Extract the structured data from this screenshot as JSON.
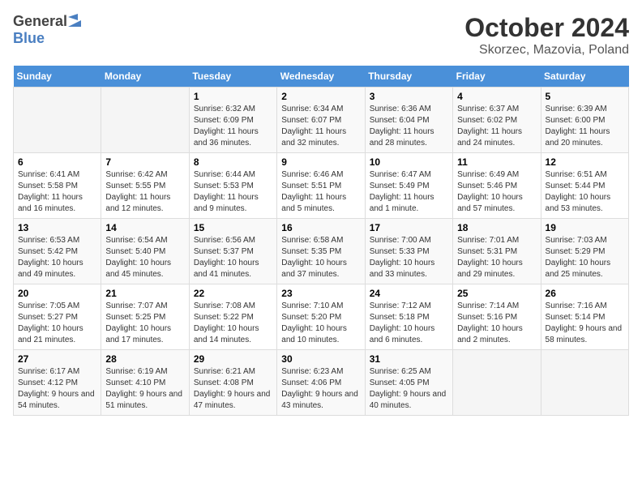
{
  "header": {
    "logo_general": "General",
    "logo_blue": "Blue",
    "month": "October 2024",
    "location": "Skorzec, Mazovia, Poland"
  },
  "days_of_week": [
    "Sunday",
    "Monday",
    "Tuesday",
    "Wednesday",
    "Thursday",
    "Friday",
    "Saturday"
  ],
  "weeks": [
    [
      {
        "day": "",
        "info": ""
      },
      {
        "day": "",
        "info": ""
      },
      {
        "day": "1",
        "info": "Sunrise: 6:32 AM\nSunset: 6:09 PM\nDaylight: 11 hours and 36 minutes."
      },
      {
        "day": "2",
        "info": "Sunrise: 6:34 AM\nSunset: 6:07 PM\nDaylight: 11 hours and 32 minutes."
      },
      {
        "day": "3",
        "info": "Sunrise: 6:36 AM\nSunset: 6:04 PM\nDaylight: 11 hours and 28 minutes."
      },
      {
        "day": "4",
        "info": "Sunrise: 6:37 AM\nSunset: 6:02 PM\nDaylight: 11 hours and 24 minutes."
      },
      {
        "day": "5",
        "info": "Sunrise: 6:39 AM\nSunset: 6:00 PM\nDaylight: 11 hours and 20 minutes."
      }
    ],
    [
      {
        "day": "6",
        "info": "Sunrise: 6:41 AM\nSunset: 5:58 PM\nDaylight: 11 hours and 16 minutes."
      },
      {
        "day": "7",
        "info": "Sunrise: 6:42 AM\nSunset: 5:55 PM\nDaylight: 11 hours and 12 minutes."
      },
      {
        "day": "8",
        "info": "Sunrise: 6:44 AM\nSunset: 5:53 PM\nDaylight: 11 hours and 9 minutes."
      },
      {
        "day": "9",
        "info": "Sunrise: 6:46 AM\nSunset: 5:51 PM\nDaylight: 11 hours and 5 minutes."
      },
      {
        "day": "10",
        "info": "Sunrise: 6:47 AM\nSunset: 5:49 PM\nDaylight: 11 hours and 1 minute."
      },
      {
        "day": "11",
        "info": "Sunrise: 6:49 AM\nSunset: 5:46 PM\nDaylight: 10 hours and 57 minutes."
      },
      {
        "day": "12",
        "info": "Sunrise: 6:51 AM\nSunset: 5:44 PM\nDaylight: 10 hours and 53 minutes."
      }
    ],
    [
      {
        "day": "13",
        "info": "Sunrise: 6:53 AM\nSunset: 5:42 PM\nDaylight: 10 hours and 49 minutes."
      },
      {
        "day": "14",
        "info": "Sunrise: 6:54 AM\nSunset: 5:40 PM\nDaylight: 10 hours and 45 minutes."
      },
      {
        "day": "15",
        "info": "Sunrise: 6:56 AM\nSunset: 5:37 PM\nDaylight: 10 hours and 41 minutes."
      },
      {
        "day": "16",
        "info": "Sunrise: 6:58 AM\nSunset: 5:35 PM\nDaylight: 10 hours and 37 minutes."
      },
      {
        "day": "17",
        "info": "Sunrise: 7:00 AM\nSunset: 5:33 PM\nDaylight: 10 hours and 33 minutes."
      },
      {
        "day": "18",
        "info": "Sunrise: 7:01 AM\nSunset: 5:31 PM\nDaylight: 10 hours and 29 minutes."
      },
      {
        "day": "19",
        "info": "Sunrise: 7:03 AM\nSunset: 5:29 PM\nDaylight: 10 hours and 25 minutes."
      }
    ],
    [
      {
        "day": "20",
        "info": "Sunrise: 7:05 AM\nSunset: 5:27 PM\nDaylight: 10 hours and 21 minutes."
      },
      {
        "day": "21",
        "info": "Sunrise: 7:07 AM\nSunset: 5:25 PM\nDaylight: 10 hours and 17 minutes."
      },
      {
        "day": "22",
        "info": "Sunrise: 7:08 AM\nSunset: 5:22 PM\nDaylight: 10 hours and 14 minutes."
      },
      {
        "day": "23",
        "info": "Sunrise: 7:10 AM\nSunset: 5:20 PM\nDaylight: 10 hours and 10 minutes."
      },
      {
        "day": "24",
        "info": "Sunrise: 7:12 AM\nSunset: 5:18 PM\nDaylight: 10 hours and 6 minutes."
      },
      {
        "day": "25",
        "info": "Sunrise: 7:14 AM\nSunset: 5:16 PM\nDaylight: 10 hours and 2 minutes."
      },
      {
        "day": "26",
        "info": "Sunrise: 7:16 AM\nSunset: 5:14 PM\nDaylight: 9 hours and 58 minutes."
      }
    ],
    [
      {
        "day": "27",
        "info": "Sunrise: 6:17 AM\nSunset: 4:12 PM\nDaylight: 9 hours and 54 minutes."
      },
      {
        "day": "28",
        "info": "Sunrise: 6:19 AM\nSunset: 4:10 PM\nDaylight: 9 hours and 51 minutes."
      },
      {
        "day": "29",
        "info": "Sunrise: 6:21 AM\nSunset: 4:08 PM\nDaylight: 9 hours and 47 minutes."
      },
      {
        "day": "30",
        "info": "Sunrise: 6:23 AM\nSunset: 4:06 PM\nDaylight: 9 hours and 43 minutes."
      },
      {
        "day": "31",
        "info": "Sunrise: 6:25 AM\nSunset: 4:05 PM\nDaylight: 9 hours and 40 minutes."
      },
      {
        "day": "",
        "info": ""
      },
      {
        "day": "",
        "info": ""
      }
    ]
  ]
}
